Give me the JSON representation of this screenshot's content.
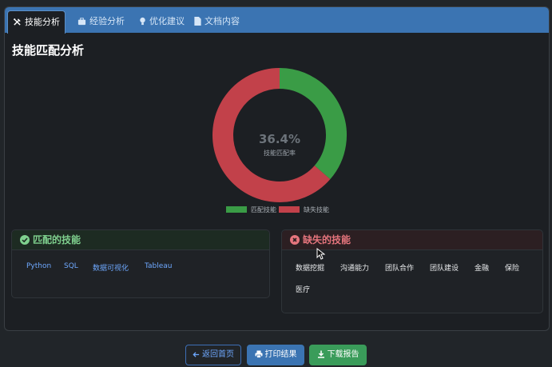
{
  "tabs": [
    {
      "label": "技能分析",
      "icon": "tools-icon",
      "active": true
    },
    {
      "label": "经验分析",
      "icon": "briefcase-icon",
      "active": false
    },
    {
      "label": "优化建议",
      "icon": "lightbulb-icon",
      "active": false
    },
    {
      "label": "文档内容",
      "icon": "file-icon",
      "active": false
    }
  ],
  "heading": "技能匹配分析",
  "chart_data": {
    "type": "pie",
    "donut": true,
    "center_value": "36.4%",
    "center_label": "技能匹配率",
    "categories": [
      "匹配技能",
      "缺失技能"
    ],
    "values": [
      36.4,
      63.6
    ],
    "colors": [
      "#3a9c46",
      "#c2414a"
    ],
    "legend_position": "bottom"
  },
  "matched": {
    "title": "匹配的技能",
    "icon": "check-circle-icon",
    "skills": [
      "Python",
      "SQL",
      "数据可视化",
      "Tableau"
    ]
  },
  "missing": {
    "title": "缺失的技能",
    "icon": "x-circle-icon",
    "skills": [
      "数据挖掘",
      "沟通能力",
      "团队合作",
      "团队建设",
      "金融",
      "保险",
      "医疗"
    ]
  },
  "buttons": {
    "home": "返回首页",
    "print": "打印结果",
    "download": "下载报告"
  }
}
